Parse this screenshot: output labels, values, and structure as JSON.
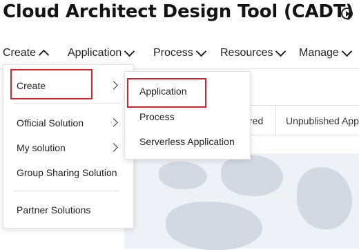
{
  "header": {
    "title": "Cloud Architect Design Tool (CADT)",
    "icon": "play-circle-icon"
  },
  "nav": [
    {
      "label": "Create",
      "state": "expanded"
    },
    {
      "label": "Application"
    },
    {
      "label": "Process"
    },
    {
      "label": "Resources"
    },
    {
      "label": "Manage"
    }
  ],
  "background": {
    "tab_fragment_1": "red",
    "tab_fragment_2": "Unpublished Appl"
  },
  "create_menu": {
    "items": [
      {
        "label": "Create",
        "has_submenu": true,
        "highlighted": true
      },
      {
        "label": "Official Solution",
        "has_submenu": true
      },
      {
        "label": "My solution",
        "has_submenu": true
      },
      {
        "label": "Group Sharing Solution"
      },
      {
        "label": "Partner Solutions"
      }
    ]
  },
  "create_submenu": {
    "items": [
      {
        "label": "Application",
        "highlighted": true
      },
      {
        "label": "Process"
      },
      {
        "label": "Serverless Application"
      }
    ]
  },
  "colors": {
    "highlight_border": "#d9202a",
    "text": "#222222"
  }
}
